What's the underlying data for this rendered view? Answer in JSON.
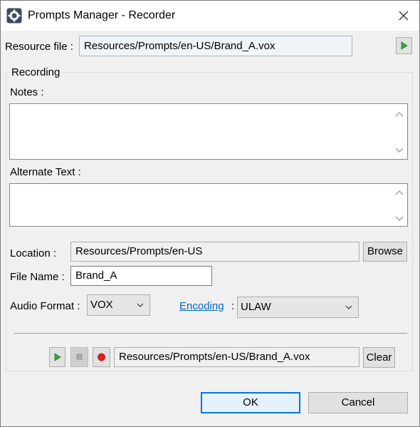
{
  "window": {
    "title": "Prompts Manager - Recorder"
  },
  "resource": {
    "label": "Resource file :",
    "value": "Resources/Prompts/en-US/Brand_A.vox"
  },
  "recording": {
    "group_label": "Recording",
    "notes_label": "Notes :",
    "notes_value": "",
    "alternate_label": "Alternate Text :",
    "alternate_value": "",
    "location_label": "Location :",
    "location_value": "Resources/Prompts/en-US",
    "browse_label": "Browse",
    "filename_label": "File Name :",
    "filename_value": "Brand_A",
    "audio_format_label": "Audio Format :",
    "audio_format_value": "VOX",
    "encoding_label": "Encoding",
    "encoding_colon": ":",
    "encoding_value": "ULAW",
    "player_path": "Resources/Prompts/en-US/Brand_A.vox",
    "clear_label": "Clear"
  },
  "footer": {
    "ok_label": "OK",
    "cancel_label": "Cancel"
  },
  "colors": {
    "play_green": "#3aa63a",
    "record_red": "#e02020",
    "link_blue": "#0066cc",
    "accent_blue": "#0078d7"
  }
}
